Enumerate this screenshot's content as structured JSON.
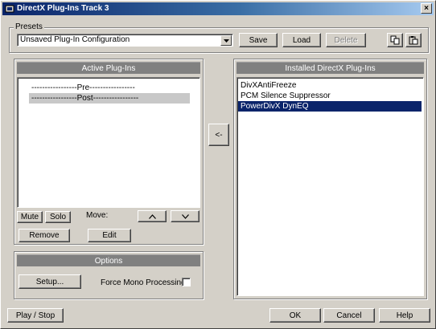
{
  "window": {
    "title": "DirectX Plug-Ins Track 3",
    "close_label": "×"
  },
  "presets": {
    "group_label": "Presets",
    "selected": "Unsaved Plug-In Configuration",
    "save_label": "Save",
    "load_label": "Load",
    "delete_label": "Delete"
  },
  "active": {
    "header": "Active Plug-Ins",
    "items": [
      "-----------------Pre-----------------",
      "-----------------Post-----------------"
    ],
    "mute_label": "Mute",
    "solo_label": "Solo",
    "move_label": "Move:",
    "up_label": "^",
    "down_label": "v",
    "remove_label": "Remove",
    "edit_label": "Edit"
  },
  "transfer": {
    "add_label": "<-"
  },
  "installed": {
    "header": "Installed DirectX Plug-Ins",
    "items": [
      "DivXAntiFreeze",
      "PCM Silence Suppressor",
      "PowerDivX DynEQ"
    ],
    "selected_index": 2
  },
  "options": {
    "header": "Options",
    "setup_label": "Setup...",
    "force_mono_label": "Force Mono Processing",
    "force_mono_checked": false
  },
  "footer": {
    "play_stop_label": "Play / Stop",
    "ok_label": "OK",
    "cancel_label": "Cancel",
    "help_label": "Help"
  }
}
